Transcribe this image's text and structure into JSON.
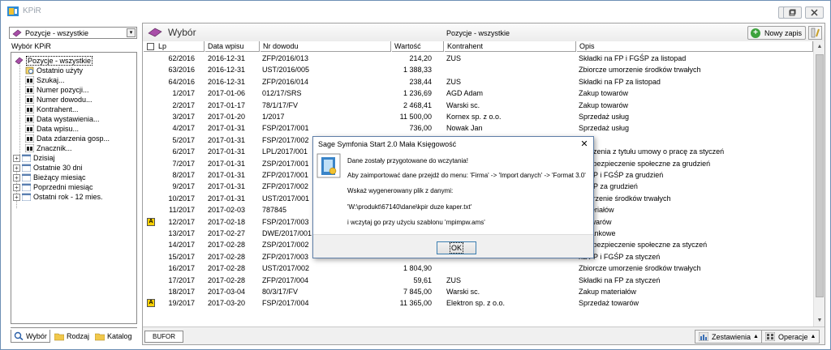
{
  "window": {
    "title": "KPiR",
    "minimize_label": "_",
    "restore_label": "▫",
    "close_label": "✕"
  },
  "left": {
    "dropdown_value": "Pozycje - wszystkie",
    "panel_label": "Wybór KPiR",
    "tree": [
      {
        "label": "Pozycje - wszystkie",
        "icon": "book-icon",
        "selected": true
      },
      {
        "label": "Ostatnio użyty",
        "icon": "recent-icon"
      },
      {
        "label": "Szukaj...",
        "icon": "binoculars-icon"
      },
      {
        "label": "Numer pozycji...",
        "icon": "binoculars-icon"
      },
      {
        "label": "Numer dowodu...",
        "icon": "binoculars-icon"
      },
      {
        "label": "Kontrahent...",
        "icon": "binoculars-icon"
      },
      {
        "label": "Data wystawienia...",
        "icon": "binoculars-icon"
      },
      {
        "label": "Data wpisu...",
        "icon": "binoculars-icon"
      },
      {
        "label": "Data zdarzenia gosp...",
        "icon": "binoculars-icon"
      },
      {
        "label": "Znacznik...",
        "icon": "binoculars-icon"
      },
      {
        "label": "Dzisiaj",
        "icon": "calendar-icon",
        "expandable": true
      },
      {
        "label": "Ostatnie 30 dni",
        "icon": "calendar-icon",
        "expandable": true
      },
      {
        "label": "Bieżący miesiąc",
        "icon": "calendar-icon",
        "expandable": true
      },
      {
        "label": "Poprzedni miesiąc",
        "icon": "calendar-icon",
        "expandable": true
      },
      {
        "label": "Ostatni rok - 12 mies.",
        "icon": "calendar-icon",
        "expandable": true
      }
    ],
    "tabs": [
      {
        "label": "Wybór",
        "icon": "search-icon",
        "active": true
      },
      {
        "label": "Rodzaj",
        "icon": "folder-icon"
      },
      {
        "label": "Katalog",
        "icon": "folder-icon"
      }
    ]
  },
  "main": {
    "title": "Wybór",
    "filter_label": "Pozycje - wszystkie",
    "new_button": "Nowy zapis",
    "columns": [
      "Lp",
      "Data wpisu",
      "Nr dowodu",
      "Wartość",
      "Kontrahent",
      "Opis"
    ],
    "rows": [
      {
        "lp": "62/2016",
        "date": "2016-12-31",
        "doc": "ZFP/2016/013",
        "value": "214,20",
        "contractor": "ZUS",
        "desc": "Składki na FP i FGŚP za listopad",
        "flag": false
      },
      {
        "lp": "63/2016",
        "date": "2016-12-31",
        "doc": "UST/2016/005",
        "value": "1 388,33",
        "contractor": "",
        "desc": "Zbiorcze umorzenie środków trwałych",
        "flag": false
      },
      {
        "lp": "64/2016",
        "date": "2016-12-31",
        "doc": "ZFP/2016/014",
        "value": "238,44",
        "contractor": "ZUS",
        "desc": "Składki na FP za listopad",
        "flag": false
      },
      {
        "lp": "1/2017",
        "date": "2017-01-06",
        "doc": "012/17/SRS",
        "value": "1 236,69",
        "contractor": "AGD Adam",
        "desc": "Zakup towarów",
        "flag": false
      },
      {
        "lp": "2/2017",
        "date": "2017-01-17",
        "doc": "78/1/17/FV",
        "value": "2 468,41",
        "contractor": "Warski sc.",
        "desc": "Zakup towarów",
        "flag": false
      },
      {
        "lp": "3/2017",
        "date": "2017-01-20",
        "doc": "1/2017",
        "value": "11 500,00",
        "contractor": "Kornex sp. z o.o.",
        "desc": "Sprzedaż usług",
        "flag": false
      },
      {
        "lp": "4/2017",
        "date": "2017-01-31",
        "doc": "FSP/2017/001",
        "value": "736,00",
        "contractor": "Nowak Jan",
        "desc": "Sprzedaż usług",
        "flag": false
      },
      {
        "lp": "5/2017",
        "date": "2017-01-31",
        "doc": "FSP/2017/002",
        "value": "",
        "contractor": "",
        "desc": "",
        "flag": false
      },
      {
        "lp": "6/2017",
        "date": "2017-01-31",
        "doc": "LPL/2017/001",
        "value": "",
        "contractor": "",
        "desc": "grodzenia z tytułu umowy o pracę za styczeń",
        "flag": false
      },
      {
        "lp": "7/2017",
        "date": "2017-01-31",
        "doc": "ZSP/2017/001",
        "value": "",
        "contractor": "",
        "desc": "na ubezpieczenie społeczne za grudzień",
        "flag": false
      },
      {
        "lp": "8/2017",
        "date": "2017-01-31",
        "doc": "ZFP/2017/001",
        "value": "",
        "contractor": "",
        "desc": "na FP i FGŚP za grudzień",
        "flag": false
      },
      {
        "lp": "9/2017",
        "date": "2017-01-31",
        "doc": "ZFP/2017/002",
        "value": "",
        "contractor": "",
        "desc": "na FP za grudzień",
        "flag": false
      },
      {
        "lp": "10/2017",
        "date": "2017-01-31",
        "doc": "UST/2017/001",
        "value": "",
        "contractor": "",
        "desc": "umorzenie środków trwałych",
        "flag": false
      },
      {
        "lp": "11/2017",
        "date": "2017-02-03",
        "doc": "787845",
        "value": "",
        "contractor": "",
        "desc": "materiałów",
        "flag": false
      },
      {
        "lp": "12/2017",
        "date": "2017-02-18",
        "doc": "FSP/2017/003",
        "value": "",
        "contractor": "",
        "desc": "ż towarów",
        "flag": true
      },
      {
        "lp": "13/2017",
        "date": "2017-02-27",
        "doc": "DWE/2017/001",
        "value": "",
        "contractor": "",
        "desc": "je bankowe",
        "flag": false
      },
      {
        "lp": "14/2017",
        "date": "2017-02-28",
        "doc": "ZSP/2017/002",
        "value": "",
        "contractor": "",
        "desc": "na ubezpieczenie społeczne za styczeń",
        "flag": false
      },
      {
        "lp": "15/2017",
        "date": "2017-02-28",
        "doc": "ZFP/2017/003",
        "value": "",
        "contractor": "",
        "desc": "na FP i FGŚP za styczeń",
        "flag": false
      },
      {
        "lp": "16/2017",
        "date": "2017-02-28",
        "doc": "UST/2017/002",
        "value": "1 804,90",
        "contractor": "",
        "desc": "Zbiorcze umorzenie środków trwałych",
        "flag": false
      },
      {
        "lp": "17/2017",
        "date": "2017-02-28",
        "doc": "ZFP/2017/004",
        "value": "59,61",
        "contractor": "ZUS",
        "desc": "Składki na FP za styczeń",
        "flag": false
      },
      {
        "lp": "18/2017",
        "date": "2017-03-04",
        "doc": "80/3/17/FV",
        "value": "7 845,00",
        "contractor": "Warski sc.",
        "desc": "Zakup materiałów",
        "flag": false
      },
      {
        "lp": "19/2017",
        "date": "2017-03-20",
        "doc": "FSP/2017/004",
        "value": "11 365,00",
        "contractor": "Elektron sp. z o.o.",
        "desc": "Sprzedaż towarów",
        "flag": true
      }
    ],
    "footer": {
      "bufor": "BUFOR",
      "zestawienia": "Zestawienia",
      "operacje": "Operacje"
    }
  },
  "dialog": {
    "title": "Sage Symfonia Start 2.0 Mała Księgowość",
    "close": "✕",
    "lines": [
      "Dane zostały przygotowane do wczytania!",
      "Aby zaimportować dane przejdź do menu: 'Firma' -> 'Import danych' -> 'Format 3.0'",
      "Wskaż wygenerowany plik z danymi:",
      "'W:\\produkt\\67140\\dane\\kpir duze kaper.txt'",
      "i wczytaj go przy użyciu szablonu 'mpimpw.ams'"
    ],
    "ok": "OK"
  },
  "colors": {
    "flag_yellow": "#f8d000",
    "ok_border": "#3c7fb1",
    "add_green": "#3ca23c"
  }
}
